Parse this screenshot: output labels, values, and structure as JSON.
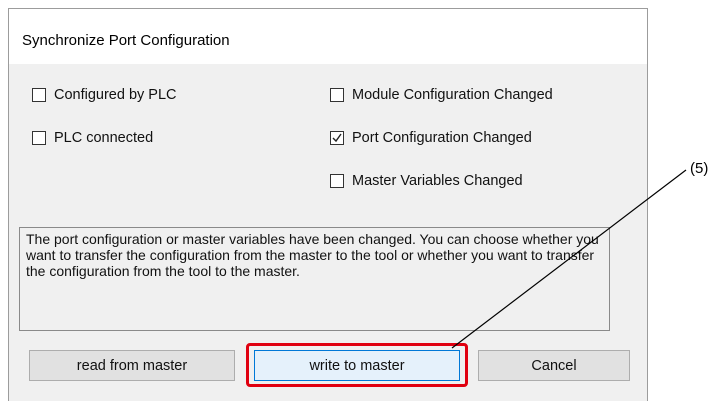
{
  "dialog": {
    "title": "Synchronize Port Configuration",
    "checkboxes": [
      {
        "label": "Configured by PLC",
        "checked": false
      },
      {
        "label": "PLC connected",
        "checked": false
      },
      {
        "label": "Module Configuration Changed",
        "checked": false
      },
      {
        "label": "Port Configuration Changed",
        "checked": true
      },
      {
        "label": "Master Variables Changed",
        "checked": false
      }
    ],
    "message": "The port configuration or master variables have been changed. You can choose whether you want to transfer the configuration from the master to the tool or whether you want to transfer the configuration from the tool to the master.",
    "buttons": {
      "read": "read from master",
      "write": "write to master",
      "cancel": "Cancel"
    }
  },
  "annotation": {
    "label": "(5)",
    "highlight_color": "#e00010"
  }
}
